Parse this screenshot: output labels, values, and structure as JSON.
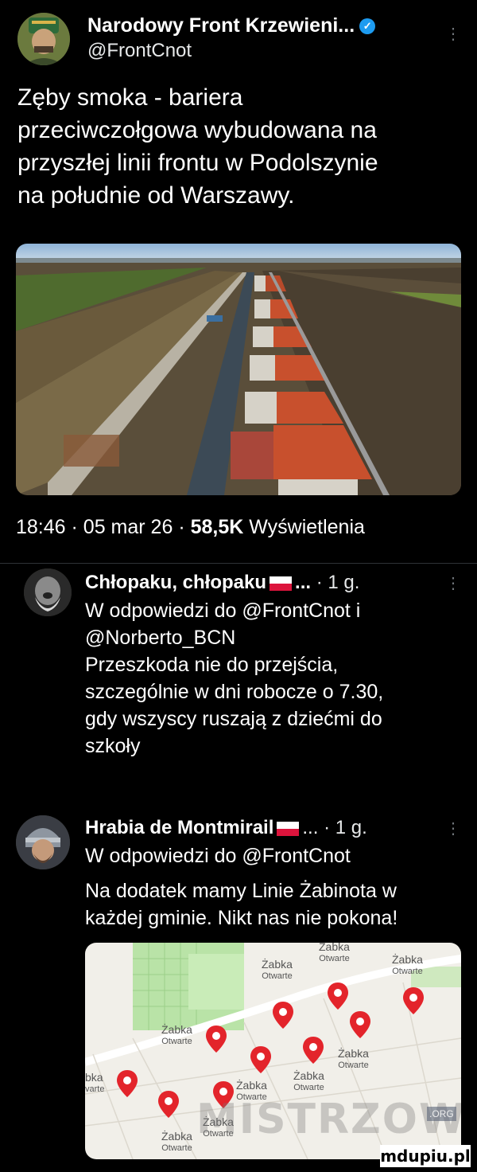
{
  "main_tweet": {
    "author_name": "Narodowy Front Krzewieni...",
    "handle": "@FrontCnot",
    "text_lines": [
      "Zęby smoka - bariera",
      "przeciwczołgowa wybudowana na",
      "przyszłej linii frontu w Podolszynie",
      "na południe od Warszawy."
    ],
    "time": "18:46",
    "date": "05 mar 26",
    "views_count": "58,5K",
    "views_label": "Wyświetlenia",
    "separator": "·"
  },
  "replies": [
    {
      "author_name": "Chłopaku, chłopaku",
      "ellipsis": "...",
      "age": "· 1 g.",
      "reply_to_lines": [
        "W odpowiedzi do @FrontCnot i",
        "@Norberto_BCN"
      ],
      "text_lines": [
        "Przeszkoda nie do przejścia,",
        "szczególnie w dni robocze o 7.30,",
        "gdy wszyscy ruszają z dziećmi do",
        "szkoły"
      ]
    },
    {
      "author_name": "Hrabia de Montmirail",
      "ellipsis": "...",
      "age": "· 1 g.",
      "reply_to_lines": [
        "W odpowiedzi do @FrontCnot"
      ],
      "text_lines": [
        "Na dodatek mamy Linie Żabinota w",
        "każdej gminie. Nikt nas nie pokona!"
      ]
    }
  ],
  "map_labels": [
    "Żabka",
    "Otwarte",
    "Żabka",
    "Otwarte",
    "Żabka",
    "Otwarte",
    "Żabka",
    "Otwarte",
    "Żabka",
    "Otwarte",
    "bka",
    "varte",
    "Żabka",
    "Otwarte",
    "Żabka",
    "Otwarte",
    "Żabka",
    "Otwarte",
    "Żabka",
    "Otwarte"
  ],
  "watermarks": {
    "site": "MISTRZOWIE",
    "org": ".ORG",
    "corner": "mdupiu.pl"
  },
  "colors": {
    "background": "#000000",
    "verified": "#1d9bf0",
    "pin": "#e3242b",
    "map_green": "#b9e3a7",
    "roof": "#c8502d"
  },
  "icons": [
    "verified-badge-icon",
    "more-options-icon",
    "poland-flag-icon",
    "map-pin-icon"
  ]
}
